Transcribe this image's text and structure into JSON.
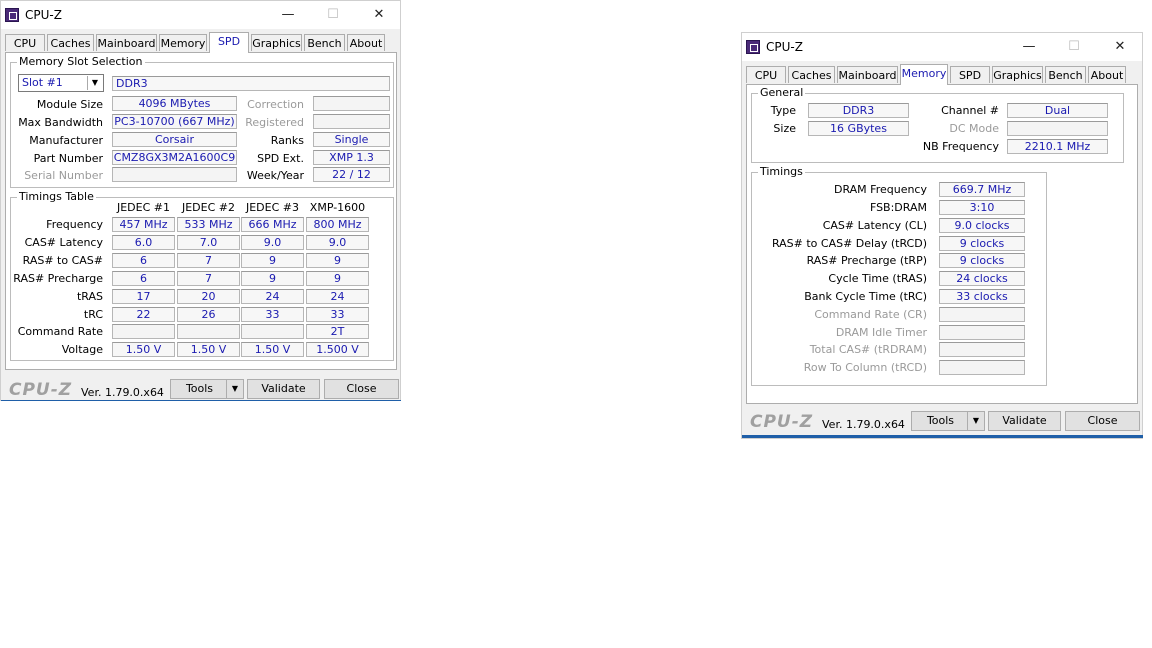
{
  "app_title": "CPU-Z",
  "tabs": [
    "CPU",
    "Caches",
    "Mainboard",
    "Memory",
    "SPD",
    "Graphics",
    "Bench",
    "About"
  ],
  "footer": {
    "logo": "CPU-Z",
    "version": "Ver. 1.79.0.x64",
    "tools": "Tools",
    "validate": "Validate",
    "close": "Close"
  },
  "spd": {
    "active_tab": "SPD",
    "group_slot": "Memory Slot Selection",
    "slot_value": "Slot #1",
    "type_value": "DDR3",
    "module_size_label": "Module Size",
    "module_size": "4096 MBytes",
    "max_bw_label": "Max Bandwidth",
    "max_bw": "PC3-10700 (667 MHz)",
    "manufacturer_label": "Manufacturer",
    "manufacturer": "Corsair",
    "part_label": "Part Number",
    "part": "CMZ8GX3M2A1600C9",
    "serial_label": "Serial Number",
    "serial": "",
    "correction_label": "Correction",
    "registered_label": "Registered",
    "ranks_label": "Ranks",
    "ranks": "Single",
    "spd_ext_label": "SPD Ext.",
    "spd_ext": "XMP 1.3",
    "week_year_label": "Week/Year",
    "week_year": "22 / 12",
    "group_timings": "Timings Table",
    "columns": [
      "JEDEC #1",
      "JEDEC #2",
      "JEDEC #3",
      "XMP-1600"
    ],
    "rows": [
      {
        "label": "Frequency",
        "values": [
          "457 MHz",
          "533 MHz",
          "666 MHz",
          "800 MHz"
        ]
      },
      {
        "label": "CAS# Latency",
        "values": [
          "6.0",
          "7.0",
          "9.0",
          "9.0"
        ]
      },
      {
        "label": "RAS# to CAS#",
        "values": [
          "6",
          "7",
          "9",
          "9"
        ]
      },
      {
        "label": "RAS# Precharge",
        "values": [
          "6",
          "7",
          "9",
          "9"
        ]
      },
      {
        "label": "tRAS",
        "values": [
          "17",
          "20",
          "24",
          "24"
        ]
      },
      {
        "label": "tRC",
        "values": [
          "22",
          "26",
          "33",
          "33"
        ]
      },
      {
        "label": "Command Rate",
        "values": [
          "",
          "",
          "",
          "2T"
        ]
      },
      {
        "label": "Voltage",
        "values": [
          "1.50 V",
          "1.50 V",
          "1.50 V",
          "1.500 V"
        ]
      }
    ]
  },
  "memory": {
    "active_tab": "Memory",
    "group_general": "General",
    "type_label": "Type",
    "type": "DDR3",
    "size_label": "Size",
    "size": "16 GBytes",
    "channel_label": "Channel #",
    "channel": "Dual",
    "dc_mode_label": "DC Mode",
    "dc_mode": "",
    "nb_freq_label": "NB Frequency",
    "nb_freq": "2210.1 MHz",
    "group_timings": "Timings",
    "timings": [
      {
        "label": "DRAM Frequency",
        "value": "669.7 MHz",
        "dim": false
      },
      {
        "label": "FSB:DRAM",
        "value": "3:10",
        "dim": false
      },
      {
        "label": "CAS# Latency (CL)",
        "value": "9.0 clocks",
        "dim": false
      },
      {
        "label": "RAS# to CAS# Delay (tRCD)",
        "value": "9 clocks",
        "dim": false
      },
      {
        "label": "RAS# Precharge (tRP)",
        "value": "9 clocks",
        "dim": false
      },
      {
        "label": "Cycle Time (tRAS)",
        "value": "24 clocks",
        "dim": false
      },
      {
        "label": "Bank Cycle Time (tRC)",
        "value": "33 clocks",
        "dim": false
      },
      {
        "label": "Command Rate (CR)",
        "value": "",
        "dim": true
      },
      {
        "label": "DRAM Idle Timer",
        "value": "",
        "dim": true
      },
      {
        "label": "Total CAS# (tRDRAM)",
        "value": "",
        "dim": true
      },
      {
        "label": "Row To Column (tRCD)",
        "value": "",
        "dim": true
      }
    ]
  }
}
